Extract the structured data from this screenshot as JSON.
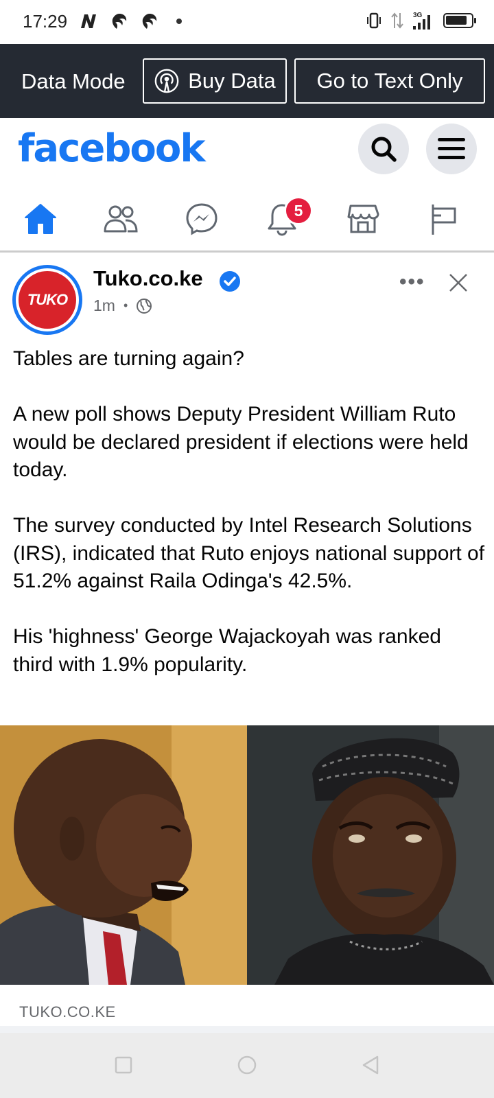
{
  "status_bar": {
    "time": "17:29",
    "network": "3G",
    "battery_level": 0.85,
    "icons": [
      "n-app-icon",
      "swirl-app-icon",
      "swirl-app-icon",
      "notification-dot",
      "vibrate-icon",
      "data-arrows-icon",
      "signal-icon",
      "battery-icon"
    ]
  },
  "data_bar": {
    "mode_label": "Data Mode",
    "buy_label": "Buy Data",
    "text_only_label": "Go to Text Only"
  },
  "header": {
    "logo": "facebook",
    "icons": [
      "search-icon",
      "menu-icon"
    ]
  },
  "nav": {
    "tabs": [
      {
        "name": "home",
        "icon": "home-icon",
        "active": true
      },
      {
        "name": "friends",
        "icon": "friends-icon"
      },
      {
        "name": "messenger",
        "icon": "messenger-icon"
      },
      {
        "name": "notifications",
        "icon": "bell-icon",
        "badge": "5"
      },
      {
        "name": "marketplace",
        "icon": "marketplace-icon"
      },
      {
        "name": "pages",
        "icon": "flag-icon"
      }
    ]
  },
  "post": {
    "avatar_text": "TUKO",
    "author": "Tuko.co.ke",
    "time": "1m",
    "privacy_icon": "globe-icon",
    "paragraphs": [
      "Tables are turning again?",
      "A new poll shows Deputy President William Ruto would be declared president if elections were held today.",
      "The survey conducted by Intel Research Solutions (IRS), indicated that Ruto enjoys national support of 51.2% against Raila Odinga's  42.5%.",
      "His 'highness' George Wajackoyah was ranked third with 1.9% popularity."
    ],
    "link_domain": "TUKO.CO.KE"
  },
  "colors": {
    "brand": "#1877f2",
    "data_bar": "#252a33",
    "badge": "#e41e3f",
    "avatar_red": "#d8232a"
  }
}
